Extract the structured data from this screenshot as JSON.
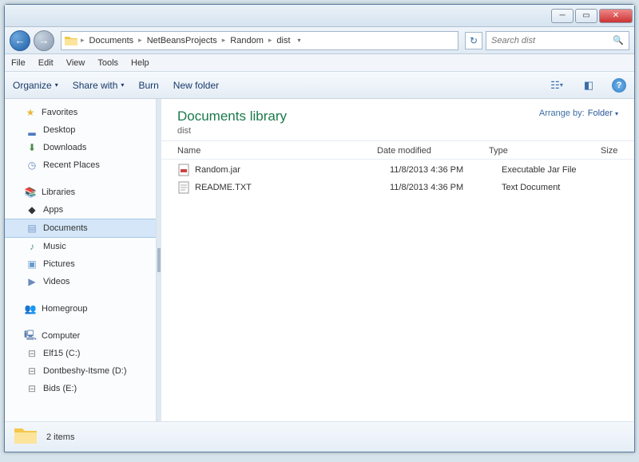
{
  "title_bar": {},
  "breadcrumb": {
    "items": [
      "Documents",
      "NetBeansProjects",
      "Random",
      "dist"
    ]
  },
  "refresh_icon": "↻",
  "search": {
    "placeholder": "Search dist"
  },
  "menu": {
    "file": "File",
    "edit": "Edit",
    "view": "View",
    "tools": "Tools",
    "help": "Help"
  },
  "toolbar": {
    "organize": "Organize",
    "share": "Share with",
    "burn": "Burn",
    "newfolder": "New folder"
  },
  "sidebar": {
    "favorites": {
      "label": "Favorites",
      "items": [
        {
          "label": "Desktop",
          "icon": "desktop"
        },
        {
          "label": "Downloads",
          "icon": "download"
        },
        {
          "label": "Recent Places",
          "icon": "recent"
        }
      ]
    },
    "libraries": {
      "label": "Libraries",
      "items": [
        {
          "label": "Apps",
          "icon": "apps"
        },
        {
          "label": "Documents",
          "icon": "doc",
          "selected": true
        },
        {
          "label": "Music",
          "icon": "music"
        },
        {
          "label": "Pictures",
          "icon": "pic"
        },
        {
          "label": "Videos",
          "icon": "vid"
        }
      ]
    },
    "homegroup": {
      "label": "Homegroup"
    },
    "computer": {
      "label": "Computer",
      "items": [
        {
          "label": "Elf15 (C:)",
          "icon": "drive"
        },
        {
          "label": "Dontbeshy-Itsme (D:)",
          "icon": "drive"
        },
        {
          "label": "Bids (E:)",
          "icon": "drive"
        }
      ]
    }
  },
  "library": {
    "title": "Documents library",
    "subtitle": "dist",
    "arrange_label": "Arrange by:",
    "arrange_value": "Folder"
  },
  "columns": {
    "name": "Name",
    "date": "Date modified",
    "type": "Type",
    "size": "Size"
  },
  "files": [
    {
      "name": "Random.jar",
      "date": "11/8/2013 4:36 PM",
      "type": "Executable Jar File",
      "icon": "jar"
    },
    {
      "name": "README.TXT",
      "date": "11/8/2013 4:36 PM",
      "type": "Text Document",
      "icon": "txt"
    }
  ],
  "status": {
    "count": "2 items"
  }
}
